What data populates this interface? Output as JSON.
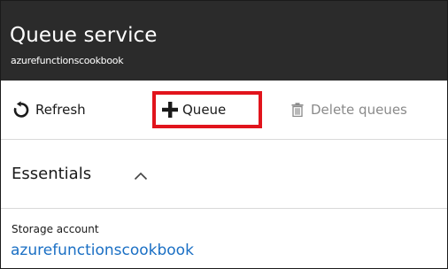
{
  "header": {
    "title": "Queue service",
    "subtitle": "azurefunctionscookbook"
  },
  "toolbar": {
    "refresh_label": "Refresh",
    "refresh_icon": "refresh-icon",
    "add_queue_label": "Queue",
    "add_queue_icon": "plus-icon",
    "delete_label": "Delete queues",
    "delete_icon": "trash-icon"
  },
  "essentials": {
    "label": "Essentials",
    "toggle_icon": "chevron-up-icon"
  },
  "storage_account": {
    "label": "Storage account",
    "value": "azurefunctionscookbook"
  },
  "colors": {
    "header_bg": "#2b2b2b",
    "highlight": "#e1141c",
    "link": "#1a6fc4",
    "disabled_text": "#8a8a8a"
  }
}
